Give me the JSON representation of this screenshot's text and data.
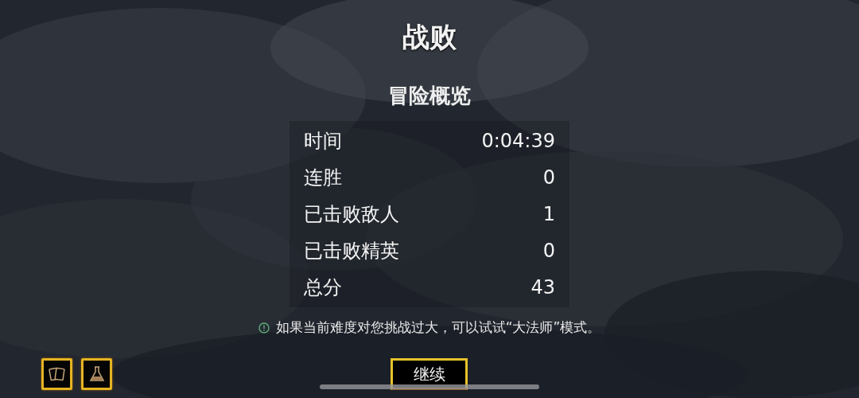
{
  "title": "战败",
  "summary": {
    "heading": "冒险概览",
    "rows": [
      {
        "label": "时间",
        "value": "0:04:39"
      },
      {
        "label": "连胜",
        "value": "0"
      },
      {
        "label": "已击败敌人",
        "value": "1"
      },
      {
        "label": "已击败精英",
        "value": "0"
      },
      {
        "label": "总分",
        "value": "43"
      }
    ]
  },
  "hint": "如果当前难度对您挑战过大，可以试试“大法师”模式。",
  "continue_button": "继续"
}
